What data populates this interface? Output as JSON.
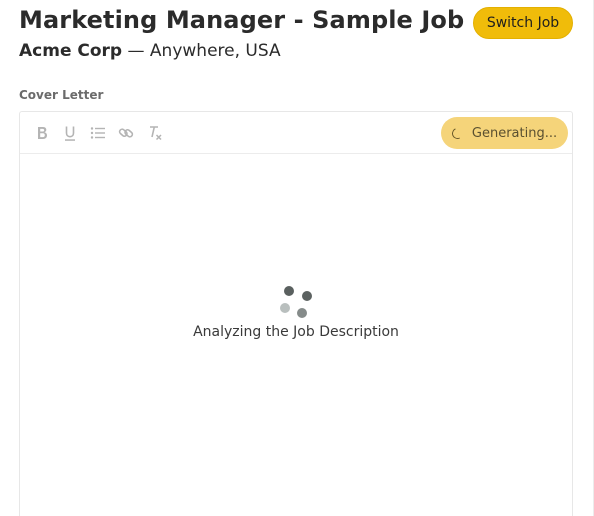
{
  "header": {
    "job_title": "Marketing Manager - Sample Job",
    "company": "Acme Corp",
    "separator": " — ",
    "location": "Anywhere, USA",
    "switch_label": "Switch Job"
  },
  "cover_letter": {
    "label": "Cover Letter",
    "toolbar": {
      "tools": [
        "bold-icon",
        "underline-icon",
        "bulleted-list-icon",
        "link-icon",
        "clear-formatting-icon"
      ],
      "generate_label": "Generating..."
    },
    "status_text": "Analyzing the Job Description"
  },
  "colors": {
    "switch_button": "#f0bc0a",
    "generate_button": "#f5d47a",
    "toolbar_icon": "#b4b4b4",
    "loader_dark": "#5a605f",
    "loader_light": "#b9bfbe"
  }
}
